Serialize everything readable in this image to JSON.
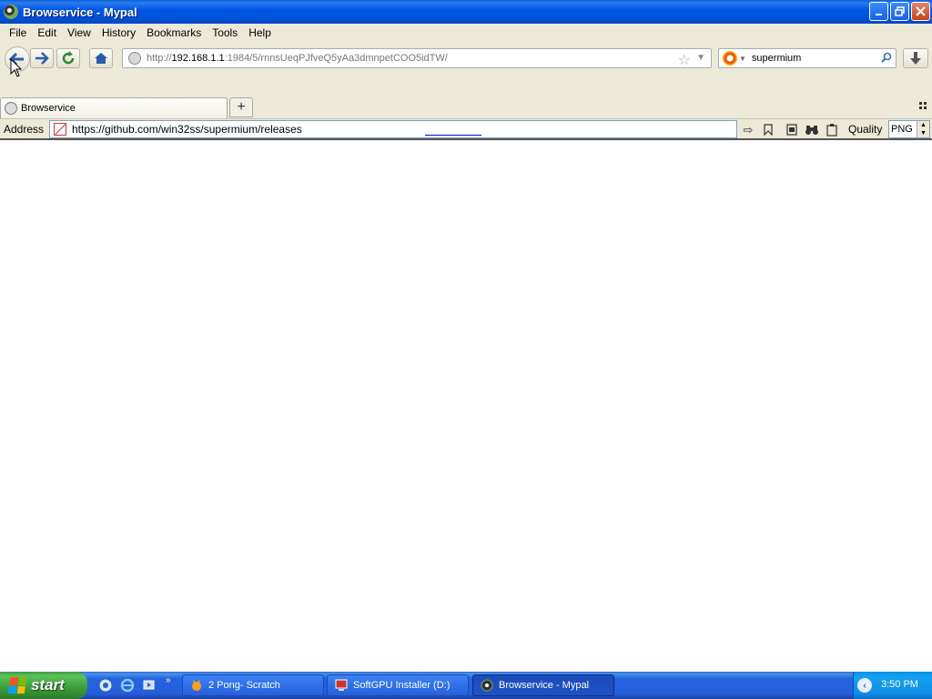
{
  "window": {
    "title": "Browservice - Mypal"
  },
  "menu": {
    "items": [
      "File",
      "Edit",
      "View",
      "History",
      "Bookmarks",
      "Tools",
      "Help"
    ]
  },
  "nav": {
    "url_prefix": "http://",
    "url_host": "192.168.1.1",
    "url_rest": ":1984/5/rnnsUeqPJfveQ5yAa3dmnpetCOO5idTW/",
    "search_value": "supermium"
  },
  "tabs": {
    "active_label": "Browservice",
    "new_tab_glyph": "+"
  },
  "address_toolbar": {
    "label": "Address",
    "value": "https://github.com/win32ss/supermium/releases",
    "quality_label": "Quality",
    "quality_value": "PNG"
  },
  "taskbar": {
    "start_label": "start",
    "tasks": [
      {
        "label": "2 Pong- Scratch"
      },
      {
        "label": "SoftGPU Installer (D:)"
      },
      {
        "label": "Browservice - Mypal"
      }
    ],
    "clock": "3:50 PM"
  },
  "icons": {
    "back": "back-arrow-icon",
    "forward": "forward-arrow-icon",
    "reload": "reload-icon",
    "home": "home-icon",
    "bookmark_star": "star-icon",
    "search": "magnifier-icon",
    "download": "download-icon"
  },
  "colors": {
    "titlebar_blue": "#0058e6",
    "chrome_beige": "#ece9d8",
    "start_green": "#3a9c3a",
    "taskbar_blue": "#245edb"
  }
}
